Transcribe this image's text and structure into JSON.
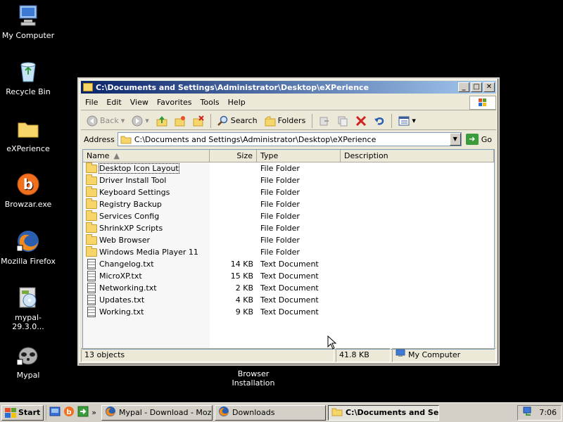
{
  "desktop": {
    "icons": [
      {
        "label": "My Computer",
        "icon": "computer-icon"
      },
      {
        "label": "Recycle Bin",
        "icon": "recycle-bin-icon"
      },
      {
        "label": "eXPerience",
        "icon": "folder-icon"
      },
      {
        "label": "Browzar.exe",
        "icon": "browzar-icon"
      },
      {
        "label": "Mozilla Firefox",
        "icon": "firefox-icon"
      },
      {
        "label": "mypal-29.3.0...",
        "icon": "installer-icon"
      },
      {
        "label": "Mypal",
        "icon": "mypal-icon"
      }
    ],
    "caption": "Browser Installation"
  },
  "window": {
    "title": "C:\\Documents and Settings\\Administrator\\Desktop\\eXPerience",
    "controls": {
      "minimize": "_",
      "maximize": "□",
      "close": "✕"
    },
    "menu": [
      "File",
      "Edit",
      "View",
      "Favorites",
      "Tools",
      "Help"
    ],
    "toolbar": {
      "back": "Back",
      "search": "Search",
      "folders": "Folders"
    },
    "address": {
      "label": "Address",
      "value": "C:\\Documents and Settings\\Administrator\\Desktop\\eXPerience",
      "go": "Go"
    },
    "columns": {
      "name": "Name",
      "size": "Size",
      "type": "Type",
      "description": "Description"
    },
    "files": [
      {
        "name": "Desktop Icon Layout",
        "size": "",
        "type": "File Folder",
        "kind": "folder"
      },
      {
        "name": "Driver Install Tool",
        "size": "",
        "type": "File Folder",
        "kind": "folder"
      },
      {
        "name": "Keyboard Settings",
        "size": "",
        "type": "File Folder",
        "kind": "folder"
      },
      {
        "name": "Registry Backup",
        "size": "",
        "type": "File Folder",
        "kind": "folder"
      },
      {
        "name": "Services Config",
        "size": "",
        "type": "File Folder",
        "kind": "folder"
      },
      {
        "name": "ShrinkXP Scripts",
        "size": "",
        "type": "File Folder",
        "kind": "folder"
      },
      {
        "name": "Web Browser",
        "size": "",
        "type": "File Folder",
        "kind": "folder"
      },
      {
        "name": "Windows Media Player 11",
        "size": "",
        "type": "File Folder",
        "kind": "folder"
      },
      {
        "name": "Changelog.txt",
        "size": "14 KB",
        "type": "Text Document",
        "kind": "text"
      },
      {
        "name": "MicroXP.txt",
        "size": "15 KB",
        "type": "Text Document",
        "kind": "text"
      },
      {
        "name": "Networking.txt",
        "size": "2 KB",
        "type": "Text Document",
        "kind": "text"
      },
      {
        "name": "Updates.txt",
        "size": "4 KB",
        "type": "Text Document",
        "kind": "text"
      },
      {
        "name": "Working.txt",
        "size": "9 KB",
        "type": "Text Document",
        "kind": "text"
      }
    ],
    "status": {
      "objects": "13 objects",
      "size": "41.8 KB",
      "location": "My Computer"
    }
  },
  "taskbar": {
    "start": "Start",
    "quicklaunch_more": "»",
    "tasks": [
      {
        "label": "Mypal - Download - Mozill...",
        "active": false
      },
      {
        "label": "Downloads",
        "active": false
      },
      {
        "label": "C:\\Documents and Se...",
        "active": true
      }
    ],
    "clock": "7:06"
  },
  "colors": {
    "desktop": "#000000",
    "titlebar_start": "#0a246a",
    "titlebar_end": "#a6caf0",
    "chrome": "#ece9d8"
  }
}
